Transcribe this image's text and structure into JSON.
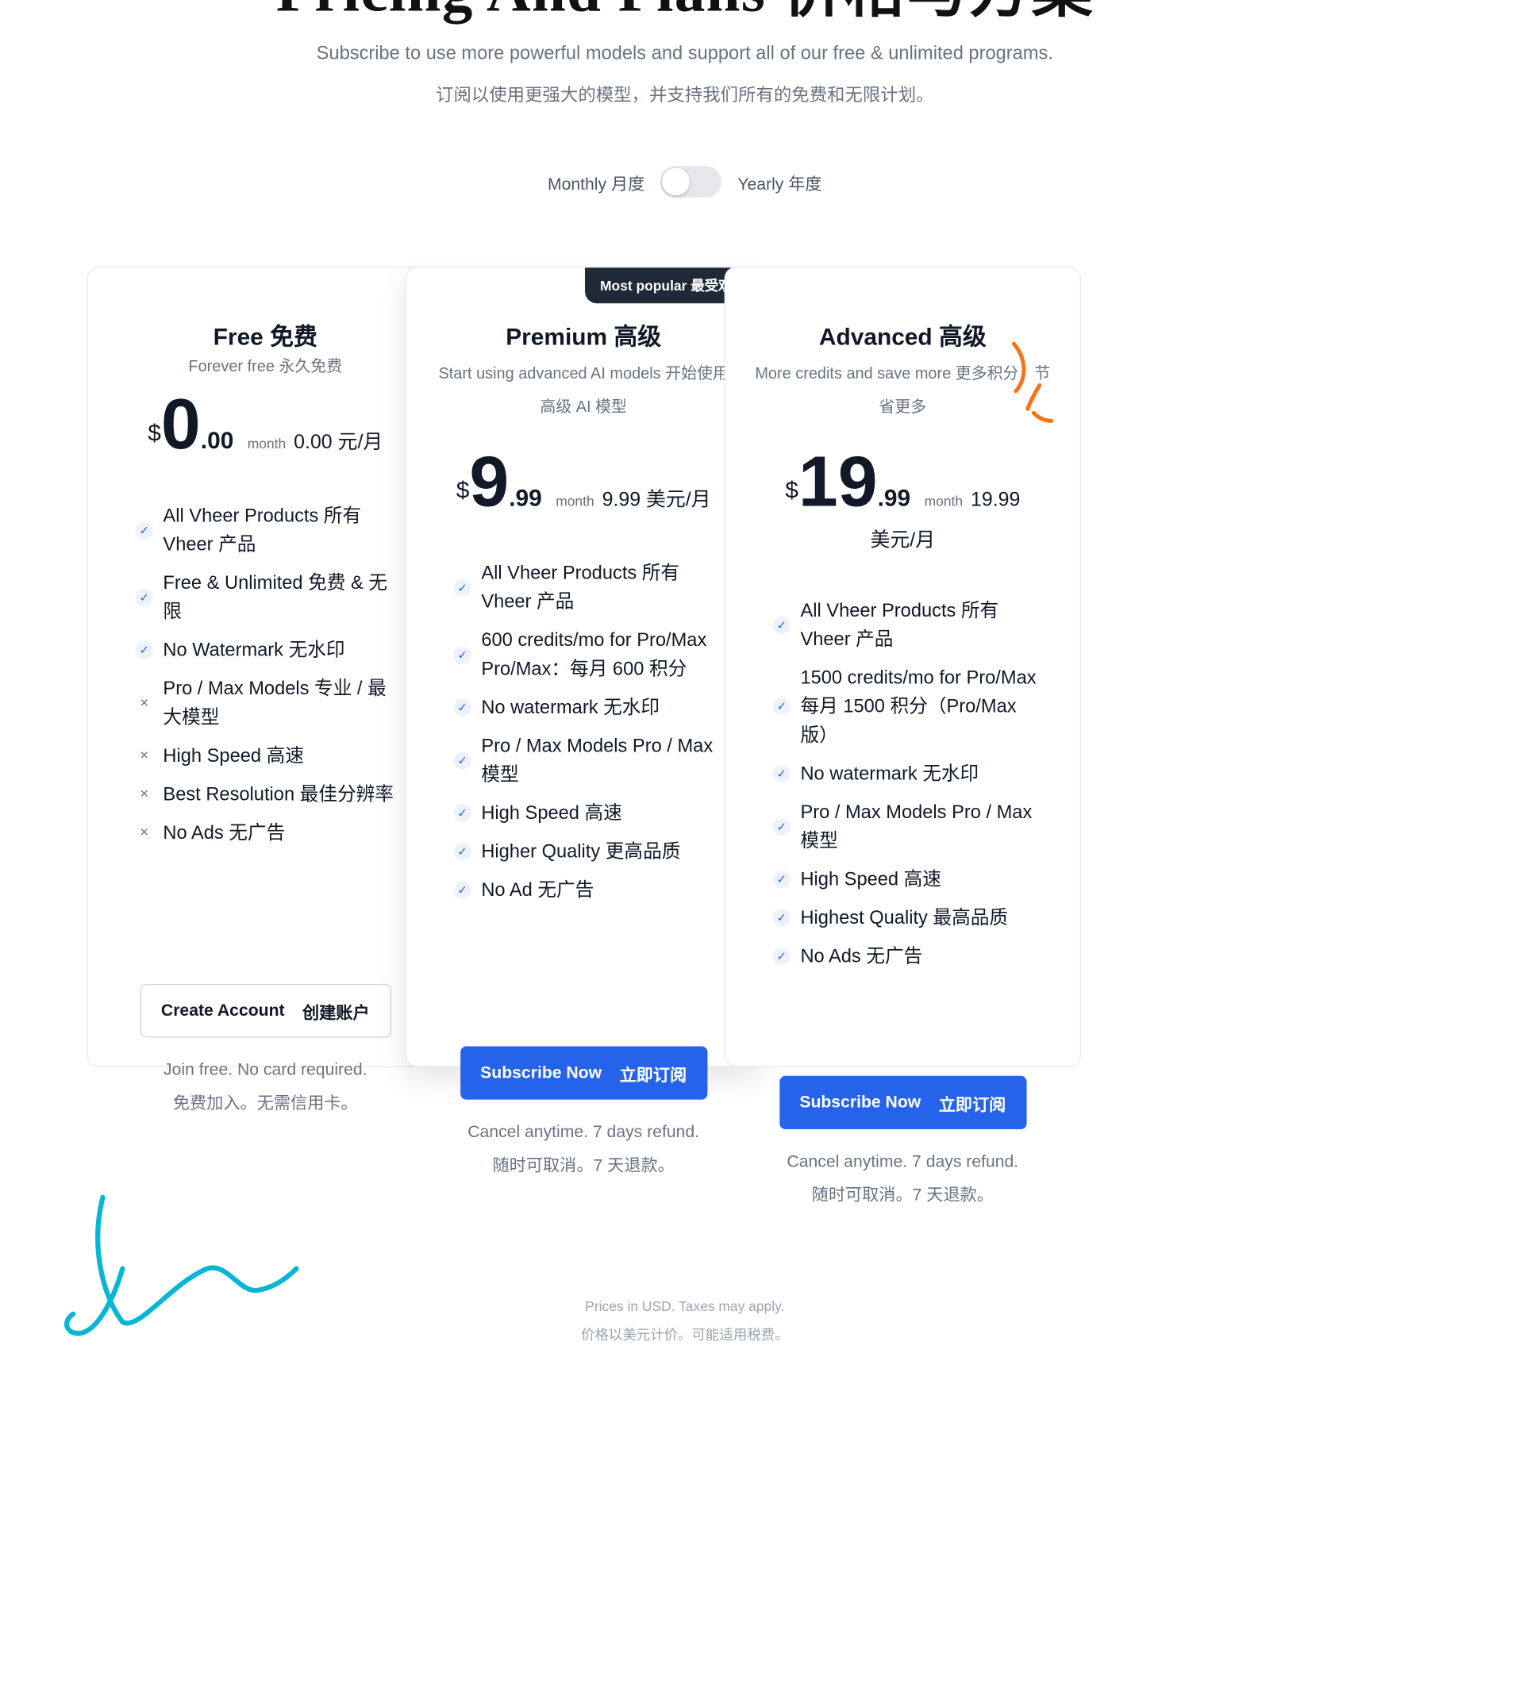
{
  "header": {
    "title": "Pricing And Plans 价格与方案",
    "subtitle_en": "Subscribe to use more powerful models and support all of our free & unlimited programs.",
    "subtitle_zh": "订阅以使用更强大的模型，并支持我们所有的免费和无限计划。"
  },
  "billing": {
    "monthly": "Monthly  月度",
    "yearly": "Yearly  年度",
    "yearly_selected": false
  },
  "plans": [
    {
      "name": "Free  免费",
      "tagline": "Forever free  永久免费",
      "price": {
        "currency": "$",
        "whole": "0",
        "cents": ".00",
        "per": "month",
        "alt": "0.00 元/月"
      },
      "features": [
        {
          "included": true,
          "text": "All Vheer Products  所有 Vheer 产品"
        },
        {
          "included": true,
          "text": "Free & Unlimited  免费 & 无限"
        },
        {
          "included": true,
          "text": "No Watermark  无水印"
        },
        {
          "included": false,
          "text": "Pro / Max Models  专业 / 最大模型"
        },
        {
          "included": false,
          "text": "High Speed  高速"
        },
        {
          "included": false,
          "text": "Best Resolution  最佳分辨率"
        },
        {
          "included": false,
          "text": "No Ads  无广告"
        }
      ],
      "cta": {
        "label_en": "Create Account",
        "label_zh": "创建账户"
      },
      "note_en": "Join free. No card required.",
      "note_zh": "免费加入。无需信用卡。"
    },
    {
      "name": "Premium  高级",
      "badge": "Most popular  最受欢迎",
      "tagline": "Start using advanced AI models 开始使用高级 AI 模型",
      "price": {
        "currency": "$",
        "whole": "9",
        "cents": ".99",
        "per": "month",
        "alt": "9.99 美元/月"
      },
      "features": [
        {
          "included": true,
          "text": "All Vheer Products  所有 Vheer 产品"
        },
        {
          "included": true,
          "text": "600 credits/mo for Pro/Max\nPro/Max：每月 600 积分"
        },
        {
          "included": true,
          "text": "No watermark  无水印"
        },
        {
          "included": true,
          "text": "Pro / Max Models  Pro / Max 模型"
        },
        {
          "included": true,
          "text": "High Speed  高速"
        },
        {
          "included": true,
          "text": "Higher Quality  更高品质"
        },
        {
          "included": true,
          "text": "No Ad  无广告"
        }
      ],
      "cta": {
        "label_en": "Subscribe Now",
        "label_zh": "立即订阅"
      },
      "note_en": "Cancel anytime. 7 days refund.",
      "note_zh": "随时可取消。7 天退款。"
    },
    {
      "name": "Advanced  高级",
      "tagline": "More credits and save more 更多积分，节省更多",
      "price": {
        "currency": "$",
        "whole": "19",
        "cents": ".99",
        "per": "month",
        "alt": "19.99 美元/月"
      },
      "features": [
        {
          "included": true,
          "text": "All Vheer Products  所有 Vheer 产品"
        },
        {
          "included": true,
          "text": "1500 credits/mo for Pro/Max\n每月 1500 积分（Pro/Max 版）"
        },
        {
          "included": true,
          "text": "No watermark  无水印"
        },
        {
          "included": true,
          "text": "Pro / Max Models  Pro / Max 模型"
        },
        {
          "included": true,
          "text": "High Speed  高速"
        },
        {
          "included": true,
          "text": "Highest Quality  最高品质"
        },
        {
          "included": true,
          "text": "No Ads  无广告"
        }
      ],
      "cta": {
        "label_en": "Subscribe Now",
        "label_zh": "立即订阅"
      },
      "note_en": "Cancel anytime. 7 days refund.",
      "note_zh": "随时可取消。7 天退款。"
    }
  ],
  "footer": {
    "line_en": "Prices in USD. Taxes may apply.",
    "line_zh": "价格以美元计价。可能适用税费。"
  },
  "colors": {
    "primary": "#2563eb",
    "dark": "#1f2937",
    "accent_orange": "#f97316",
    "accent_cyan": "#06b6d4"
  }
}
